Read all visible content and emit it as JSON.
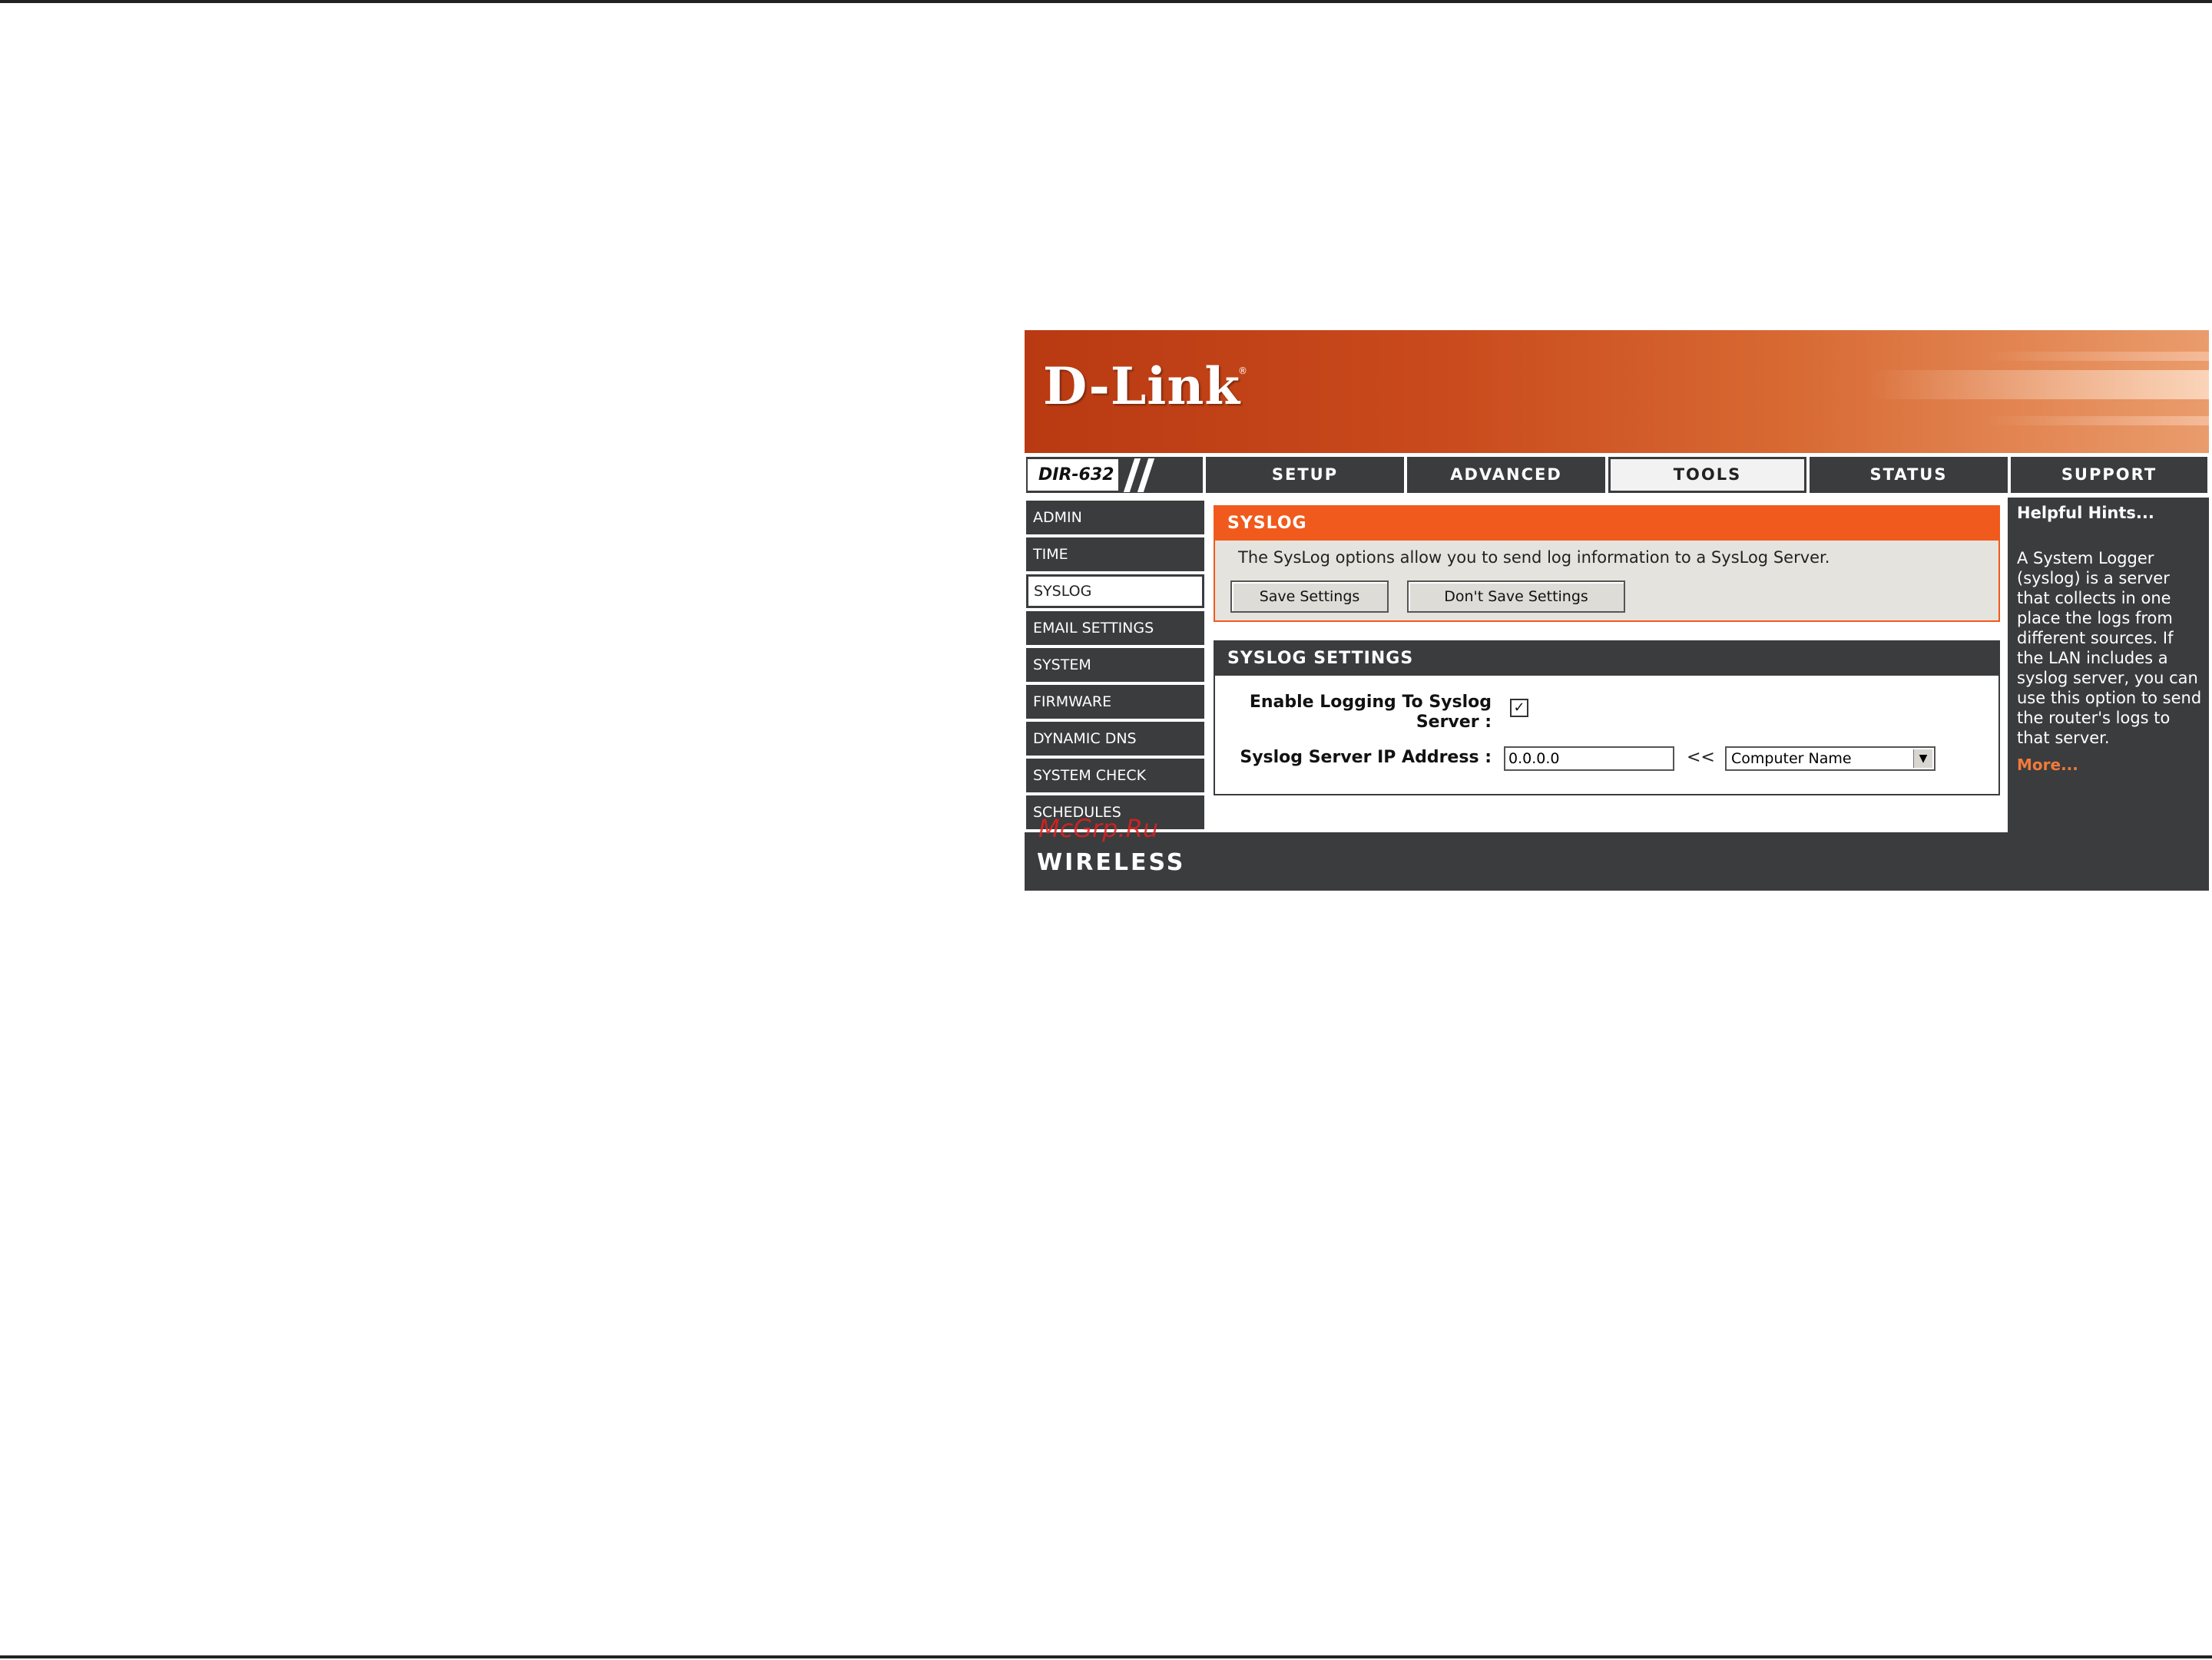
{
  "brand": {
    "logo": "D-Link",
    "footer": "WIRELESS",
    "watermark": "McGrp.Ru"
  },
  "model": "DIR-632",
  "tabs": [
    {
      "label": "SETUP"
    },
    {
      "label": "ADVANCED"
    },
    {
      "label": "TOOLS"
    },
    {
      "label": "STATUS"
    },
    {
      "label": "SUPPORT"
    }
  ],
  "sidebar": [
    {
      "label": "ADMIN"
    },
    {
      "label": "TIME"
    },
    {
      "label": "SYSLOG"
    },
    {
      "label": "EMAIL SETTINGS"
    },
    {
      "label": "SYSTEM"
    },
    {
      "label": "FIRMWARE"
    },
    {
      "label": "DYNAMIC DNS"
    },
    {
      "label": "SYSTEM CHECK"
    },
    {
      "label": "SCHEDULES"
    }
  ],
  "syslog": {
    "title": "SYSLOG",
    "description": "The SysLog options allow you to send log information to a SysLog Server.",
    "save_label": "Save Settings",
    "dont_save_label": "Don't Save Settings"
  },
  "settings": {
    "title": "SYSLOG SETTINGS",
    "enable_label_1": "Enable Logging To Syslog",
    "enable_label_2": "Server :",
    "enable_checked": true,
    "check_glyph": "✓",
    "ip_label": "Syslog Server IP Address :",
    "ip_value": "0.0.0.0",
    "arrows": "<<",
    "computer_select": "Computer Name",
    "dropdown_glyph": "▼"
  },
  "hints": {
    "title": "Helpful Hints...",
    "body": "A System Logger (syslog) is a server that collects in one place the logs from different sources. If the LAN includes a syslog server, you can use this option to send the router's logs to that server.",
    "more": "More..."
  },
  "colors": {
    "accent": "#f05a1c",
    "dark": "#3a3c3e",
    "link": "#f07a3a"
  }
}
